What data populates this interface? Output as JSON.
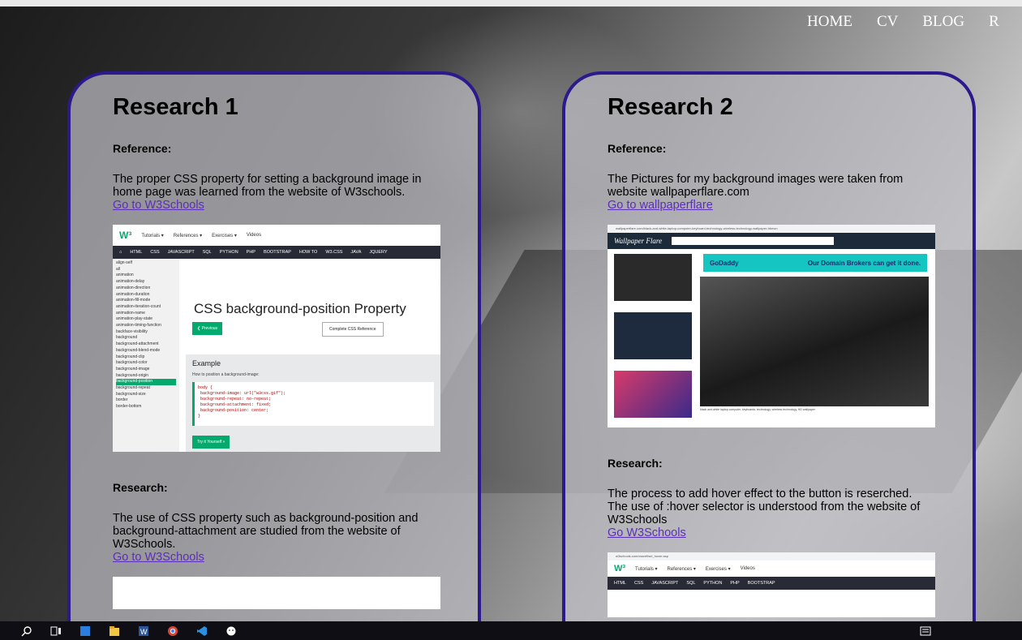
{
  "nav": {
    "items": [
      "HOME",
      "CV",
      "BLOG",
      "R"
    ]
  },
  "cards": [
    {
      "title": "Research 1",
      "reference_label": "Reference:",
      "reference_text": "The proper CSS property for setting a background image in home page was learned from the website of W3schools.",
      "reference_link": "Go to W3Schools",
      "research_label": "Research:",
      "research_text": "The use of CSS property such as background-position and background-attachment are studied from the website of W3Schools.",
      "research_link": "Go to W3Schools"
    },
    {
      "title": "Research 2",
      "reference_label": "Reference:",
      "reference_text": "The Pictures for my background images were taken from website wallpaperflare.com",
      "reference_link": "Go to wallpaperflare",
      "research_label": "Research:",
      "research_text": "The process to add hover effect to the button is reserched. The use of :hover selector is understood from the website of W3Schools",
      "research_link": "Go W3Schools"
    }
  ],
  "w3shot": {
    "menu": [
      "Tutorials ▾",
      "References ▾",
      "Exercises ▾",
      "Videos"
    ],
    "navbar": [
      "HTML",
      "CSS",
      "JAVASCRIPT",
      "SQL",
      "PYTHON",
      "PHP",
      "BOOTSTRAP",
      "HOW TO",
      "W3.CSS",
      "JAVA",
      "JQUERY"
    ],
    "heading": "CSS background-position Property",
    "prev": "❮ Previous",
    "complete": "Complete CSS Reference",
    "example_title": "Example",
    "example_desc": "How to position a background-image:",
    "try": "Try it Yourself »",
    "side_items": [
      "align-self",
      "all",
      "animation",
      "animation-delay",
      "animation-direction",
      "animation-duration",
      "animation-fill-mode",
      "animation-iteration-count",
      "animation-name",
      "animation-play-state",
      "animation-timing-function",
      "backface-visibility",
      "background",
      "background-attachment",
      "background-blend-mode",
      "background-clip",
      "background-color",
      "background-image",
      "background-origin",
      "background-position",
      "background-repeat",
      "background-size",
      "border",
      "border-bottom"
    ]
  },
  "wpshot": {
    "url": "wallpaperflare.com/black-and-white-laptop-computer-keyboard-technology-wireless-technology-wallpaper-hbmcn",
    "brand": "Wallpaper Flare",
    "ad_brand": "GoDaddy",
    "ad_text": "Our Domain Brokers can get it done.",
    "caption": "black and white laptop computer, keyboards, technology, wireless technology, HD wallpaper"
  },
  "w3shot2": {
    "url": "w3schools.com/cssref/sel_hover.asp"
  },
  "colors": {
    "card_border": "#2a1a8c",
    "link": "#5a2fb5",
    "w3_green": "#04AA6D"
  }
}
